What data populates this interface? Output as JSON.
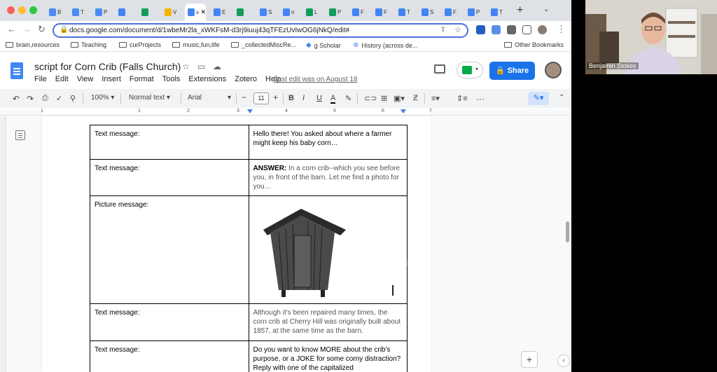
{
  "tabs": [
    {
      "short": "B",
      "color": "#4c8bf5"
    },
    {
      "short": "T",
      "color": "#4c8bf5"
    },
    {
      "short": "P",
      "color": "#4c8bf5"
    },
    {
      "short": "",
      "color": "#4285f4"
    },
    {
      "short": "",
      "color": "#0f9d58"
    },
    {
      "short": "V",
      "color": "#f4b400"
    },
    {
      "short": "sc",
      "color": "#4285f4",
      "active": true
    },
    {
      "short": "E",
      "color": "#4285f4"
    },
    {
      "short": "",
      "color": "#0f9d58"
    },
    {
      "short": "S",
      "color": "#4285f4"
    },
    {
      "short": "n",
      "color": "#4285f4"
    },
    {
      "short": "L",
      "color": "#0f9d58"
    },
    {
      "short": "P",
      "color": "#0f9d58"
    },
    {
      "short": "F",
      "color": "#4285f4"
    },
    {
      "short": "F",
      "color": "#4285f4"
    },
    {
      "short": "T",
      "color": "#4285f4"
    },
    {
      "short": "S",
      "color": "#4285f4"
    },
    {
      "short": "F",
      "color": "#4285f4"
    },
    {
      "short": "P",
      "color": "#4285f4"
    },
    {
      "short": "T",
      "color": "#4285f4"
    }
  ],
  "address": {
    "url": "docs.google.com/document/d/1wbeMr2la_xWKFsM-d3rj9iuuj43qTFEzUvIwOG6jNkQ/edit#"
  },
  "bookmarks": [
    "brain,resources",
    "Teaching",
    "curProjects",
    "music,fun,life",
    "_collectedMiscRe...",
    "g Scholar",
    "History (across de...",
    "Other Bookmarks"
  ],
  "doc": {
    "title": "script for Corn Crib (Falls Church)",
    "menus": [
      "File",
      "Edit",
      "View",
      "Insert",
      "Format",
      "Tools",
      "Extensions",
      "Zotero",
      "Help"
    ],
    "last_edit": "Last edit was on August 18",
    "share": "Share"
  },
  "toolbar": {
    "zoom": "100%",
    "style": "Normal text",
    "font": "Arial",
    "size": "11"
  },
  "ruler": [
    "1",
    "1",
    "2",
    "3",
    "4",
    "5",
    "6",
    "7"
  ],
  "table": [
    {
      "label": "Text message:",
      "content": "Hello there! You asked about where a farmer might keep his baby corn…",
      "muted": false
    },
    {
      "label": "Text message:",
      "bold": "ANSWER:",
      "content": " In a corn crib--which you see before you, in front of the barn. Let me find a photo for you…",
      "muted": true
    },
    {
      "label": "Picture message:",
      "image": "wooden-corn-crib-photo"
    },
    {
      "label": "Text message:",
      "content": "Although it's been repaired many times, the corn crib at Cherry Hill was originally built about 1857, at the same time as the barn.",
      "muted": true
    },
    {
      "label": "Text message:",
      "content": "Do you want to know MORE about the crib's purpose, or a JOKE for some corny distraction? Reply with one of the capitalized",
      "muted": false
    }
  ],
  "participant": {
    "name": "Benjamin Stokes"
  }
}
